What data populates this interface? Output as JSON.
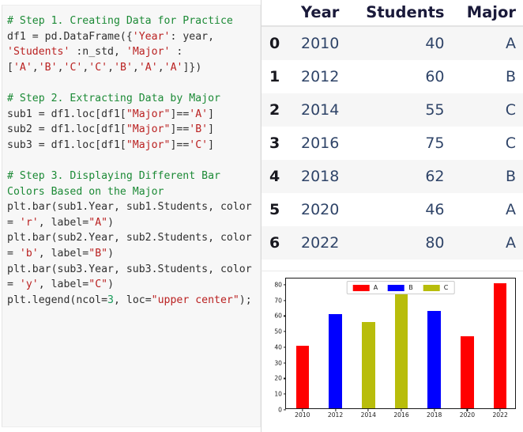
{
  "notebook": {
    "code_cell": {
      "language": "python",
      "lines": [
        [
          {
            "t": "# Step 1. Creating Data for Practice",
            "c": "cm"
          }
        ],
        [
          {
            "t": "df1 = pd.DataFrame({",
            "c": "pl"
          },
          {
            "t": "'Year'",
            "c": "st"
          },
          {
            "t": ": year, ",
            "c": "pl"
          },
          {
            "t": "'Students'",
            "c": "st"
          },
          {
            "t": " :n_std, ",
            "c": "pl"
          },
          {
            "t": "'Major'",
            "c": "st"
          },
          {
            "t": " : [",
            "c": "pl"
          },
          {
            "t": "'A'",
            "c": "st"
          },
          {
            "t": ",",
            "c": "pl"
          },
          {
            "t": "'B'",
            "c": "st"
          },
          {
            "t": ",",
            "c": "pl"
          },
          {
            "t": "'C'",
            "c": "st"
          },
          {
            "t": ",",
            "c": "pl"
          },
          {
            "t": "'C'",
            "c": "st"
          },
          {
            "t": ",",
            "c": "pl"
          },
          {
            "t": "'B'",
            "c": "st"
          },
          {
            "t": ",",
            "c": "pl"
          },
          {
            "t": "'A'",
            "c": "st"
          },
          {
            "t": ",",
            "c": "pl"
          },
          {
            "t": "'A'",
            "c": "st"
          },
          {
            "t": "]})",
            "c": "pl"
          }
        ],
        [],
        [
          {
            "t": "# Step 2. Extracting Data by Major",
            "c": "cm"
          }
        ],
        [
          {
            "t": "sub1 = df1.loc[df1[",
            "c": "pl"
          },
          {
            "t": "\"Major\"",
            "c": "st"
          },
          {
            "t": "]==",
            "c": "pl"
          },
          {
            "t": "'A'",
            "c": "st"
          },
          {
            "t": "]",
            "c": "pl"
          }
        ],
        [
          {
            "t": "sub2 = df1.loc[df1[",
            "c": "pl"
          },
          {
            "t": "\"Major\"",
            "c": "st"
          },
          {
            "t": "]==",
            "c": "pl"
          },
          {
            "t": "'B'",
            "c": "st"
          },
          {
            "t": "]",
            "c": "pl"
          }
        ],
        [
          {
            "t": "sub3 = df1.loc[df1[",
            "c": "pl"
          },
          {
            "t": "\"Major\"",
            "c": "st"
          },
          {
            "t": "]==",
            "c": "pl"
          },
          {
            "t": "'C'",
            "c": "st"
          },
          {
            "t": "]",
            "c": "pl"
          }
        ],
        [],
        [
          {
            "t": "# Step 3. Displaying Different Bar Colors Based on the Major",
            "c": "cm"
          }
        ],
        [
          {
            "t": "plt.bar(sub1.Year, sub1.Students, color = ",
            "c": "pl"
          },
          {
            "t": "'r'",
            "c": "st"
          },
          {
            "t": ", label=",
            "c": "pl"
          },
          {
            "t": "\"A\"",
            "c": "st"
          },
          {
            "t": ")",
            "c": "pl"
          }
        ],
        [
          {
            "t": "plt.bar(sub2.Year, sub2.Students, color = ",
            "c": "pl"
          },
          {
            "t": "'b'",
            "c": "st"
          },
          {
            "t": ", label=",
            "c": "pl"
          },
          {
            "t": "\"B\"",
            "c": "st"
          },
          {
            "t": ")",
            "c": "pl"
          }
        ],
        [
          {
            "t": "plt.bar(sub3.Year, sub3.Students, color = ",
            "c": "pl"
          },
          {
            "t": "'y'",
            "c": "st"
          },
          {
            "t": ", label=",
            "c": "pl"
          },
          {
            "t": "\"C\"",
            "c": "st"
          },
          {
            "t": ")",
            "c": "pl"
          }
        ],
        [
          {
            "t": "plt.legend(ncol=",
            "c": "pl"
          },
          {
            "t": "3",
            "c": "nu"
          },
          {
            "t": ", loc=",
            "c": "pl"
          },
          {
            "t": "\"upper center\"",
            "c": "st"
          },
          {
            "t": ");",
            "c": "pl"
          }
        ]
      ]
    },
    "dataframe": {
      "index_header": "",
      "columns": [
        "Year",
        "Students",
        "Major"
      ],
      "index": [
        "0",
        "1",
        "2",
        "3",
        "4",
        "5",
        "6"
      ],
      "rows": [
        [
          "2010",
          "40",
          "A"
        ],
        [
          "2012",
          "60",
          "B"
        ],
        [
          "2014",
          "55",
          "C"
        ],
        [
          "2016",
          "75",
          "C"
        ],
        [
          "2018",
          "62",
          "B"
        ],
        [
          "2020",
          "46",
          "A"
        ],
        [
          "2022",
          "80",
          "A"
        ]
      ]
    }
  },
  "colors": {
    "red": "#ff0000",
    "blue": "#0000ff",
    "yellow": "#b8bd0b",
    "code_bg": "#f7f7f7",
    "comment": "#1c8a36",
    "string": "#ba2121"
  },
  "chart_data": {
    "type": "bar",
    "title": "",
    "xlabel": "",
    "ylabel": "",
    "categories": [
      "2010",
      "2012",
      "2014",
      "2016",
      "2018",
      "2020",
      "2022"
    ],
    "values": [
      40,
      60,
      55,
      75,
      62,
      46,
      80
    ],
    "bar_groups": [
      "A",
      "B",
      "C",
      "C",
      "B",
      "A",
      "A"
    ],
    "bar_colors": [
      "#ff0000",
      "#0000ff",
      "#b8bd0b",
      "#b8bd0b",
      "#0000ff",
      "#ff0000",
      "#ff0000"
    ],
    "series": [
      {
        "name": "A",
        "color": "#ff0000",
        "x": [
          "2010",
          "2020",
          "2022"
        ],
        "values": [
          40,
          46,
          80
        ]
      },
      {
        "name": "B",
        "color": "#0000ff",
        "x": [
          "2012",
          "2018"
        ],
        "values": [
          60,
          62
        ]
      },
      {
        "name": "C",
        "color": "#b8bd0b",
        "x": [
          "2014",
          "2016"
        ],
        "values": [
          55,
          75
        ]
      }
    ],
    "ylim": [
      0,
      84
    ],
    "yticks": [
      0,
      10,
      20,
      30,
      40,
      50,
      60,
      70,
      80
    ],
    "ytick_labels": [
      "0",
      "10",
      "20",
      "30",
      "40",
      "50",
      "60",
      "70",
      "80"
    ],
    "xtick_labels": [
      "2010",
      "2012",
      "2014",
      "2016",
      "2018",
      "2020",
      "2022"
    ],
    "grid": false,
    "legend": {
      "position": "upper center",
      "ncol": 3,
      "entries": [
        {
          "label": "A",
          "color": "#ff0000"
        },
        {
          "label": "B",
          "color": "#0000ff"
        },
        {
          "label": "C",
          "color": "#b8bd0b"
        }
      ]
    }
  }
}
